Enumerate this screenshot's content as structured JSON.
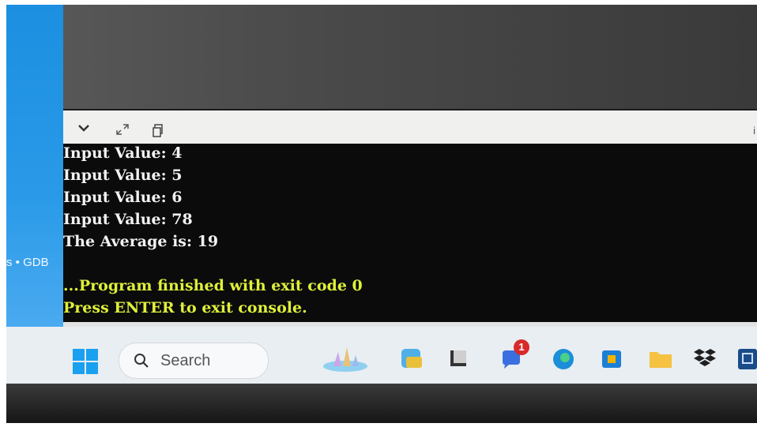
{
  "window": {
    "side_label": "s • GDB",
    "toolbar": {
      "icons": [
        "chevron-down-icon",
        "expand-icon",
        "copy-icon"
      ],
      "right_text": "i"
    }
  },
  "console": {
    "output_lines": [
      "Input Value: 4",
      "Input Value: 5",
      "Input Value: 6",
      "Input Value: 78",
      "The Average is: 19"
    ],
    "finish_lines": [
      "...Program finished with exit code 0",
      "Press ENTER to exit console."
    ],
    "colors": {
      "background": "#0b0b0b",
      "output": "#f2f2f2",
      "finish": "#dff03a"
    }
  },
  "taskbar": {
    "search_placeholder": "Search",
    "apps": [
      "start-icon",
      "widgets-icon",
      "app-icon",
      "terminal-icon",
      "chat-icon",
      "edge-icon",
      "store-icon",
      "file-explorer-icon",
      "dropbox-icon",
      "app-icon"
    ],
    "chat_badge": "1"
  }
}
